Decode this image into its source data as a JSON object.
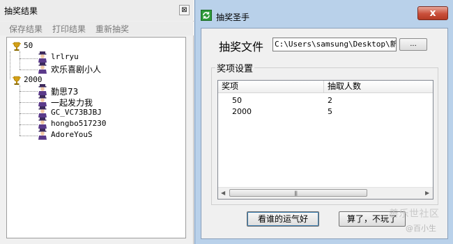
{
  "left_panel": {
    "title": "抽奖结果",
    "close_glyph": "⊠",
    "menu": [
      "保存结果",
      "打印结果",
      "重新抽奖"
    ],
    "groups": [
      {
        "prize": "50",
        "winners": [
          "lrlryu",
          "欢乐喜剧小人"
        ]
      },
      {
        "prize": "2000",
        "winners": [
          "勤思73",
          "一起发力我",
          "GC_VC73BJBJ",
          "hongbo517230",
          "AdoreYouS"
        ]
      }
    ]
  },
  "dialog": {
    "title": "抽奖圣手",
    "close_glyph": "x",
    "file_label": "抽奖文件",
    "file_path": "C:\\Users\\samsung\\Desktop\\新建",
    "browse_label": "...",
    "group_title": "奖项设置",
    "columns": [
      "奖项",
      "抽取人数"
    ],
    "rows": [
      {
        "prize": "50",
        "count": "2"
      },
      {
        "prize": "2000",
        "count": "5"
      }
    ],
    "scroll_grip": "|||",
    "lucky_button": "看谁的运气好",
    "quit_button": "算了，不玩了"
  },
  "watermark": {
    "main": "善乐世社区",
    "sub": "@百小生"
  },
  "colors": {
    "dialog_frame": "#b9d1ea",
    "close_red": "#c94f3a",
    "trophy_gold": "#d4a017",
    "person_purple": "#5b3a8a"
  }
}
